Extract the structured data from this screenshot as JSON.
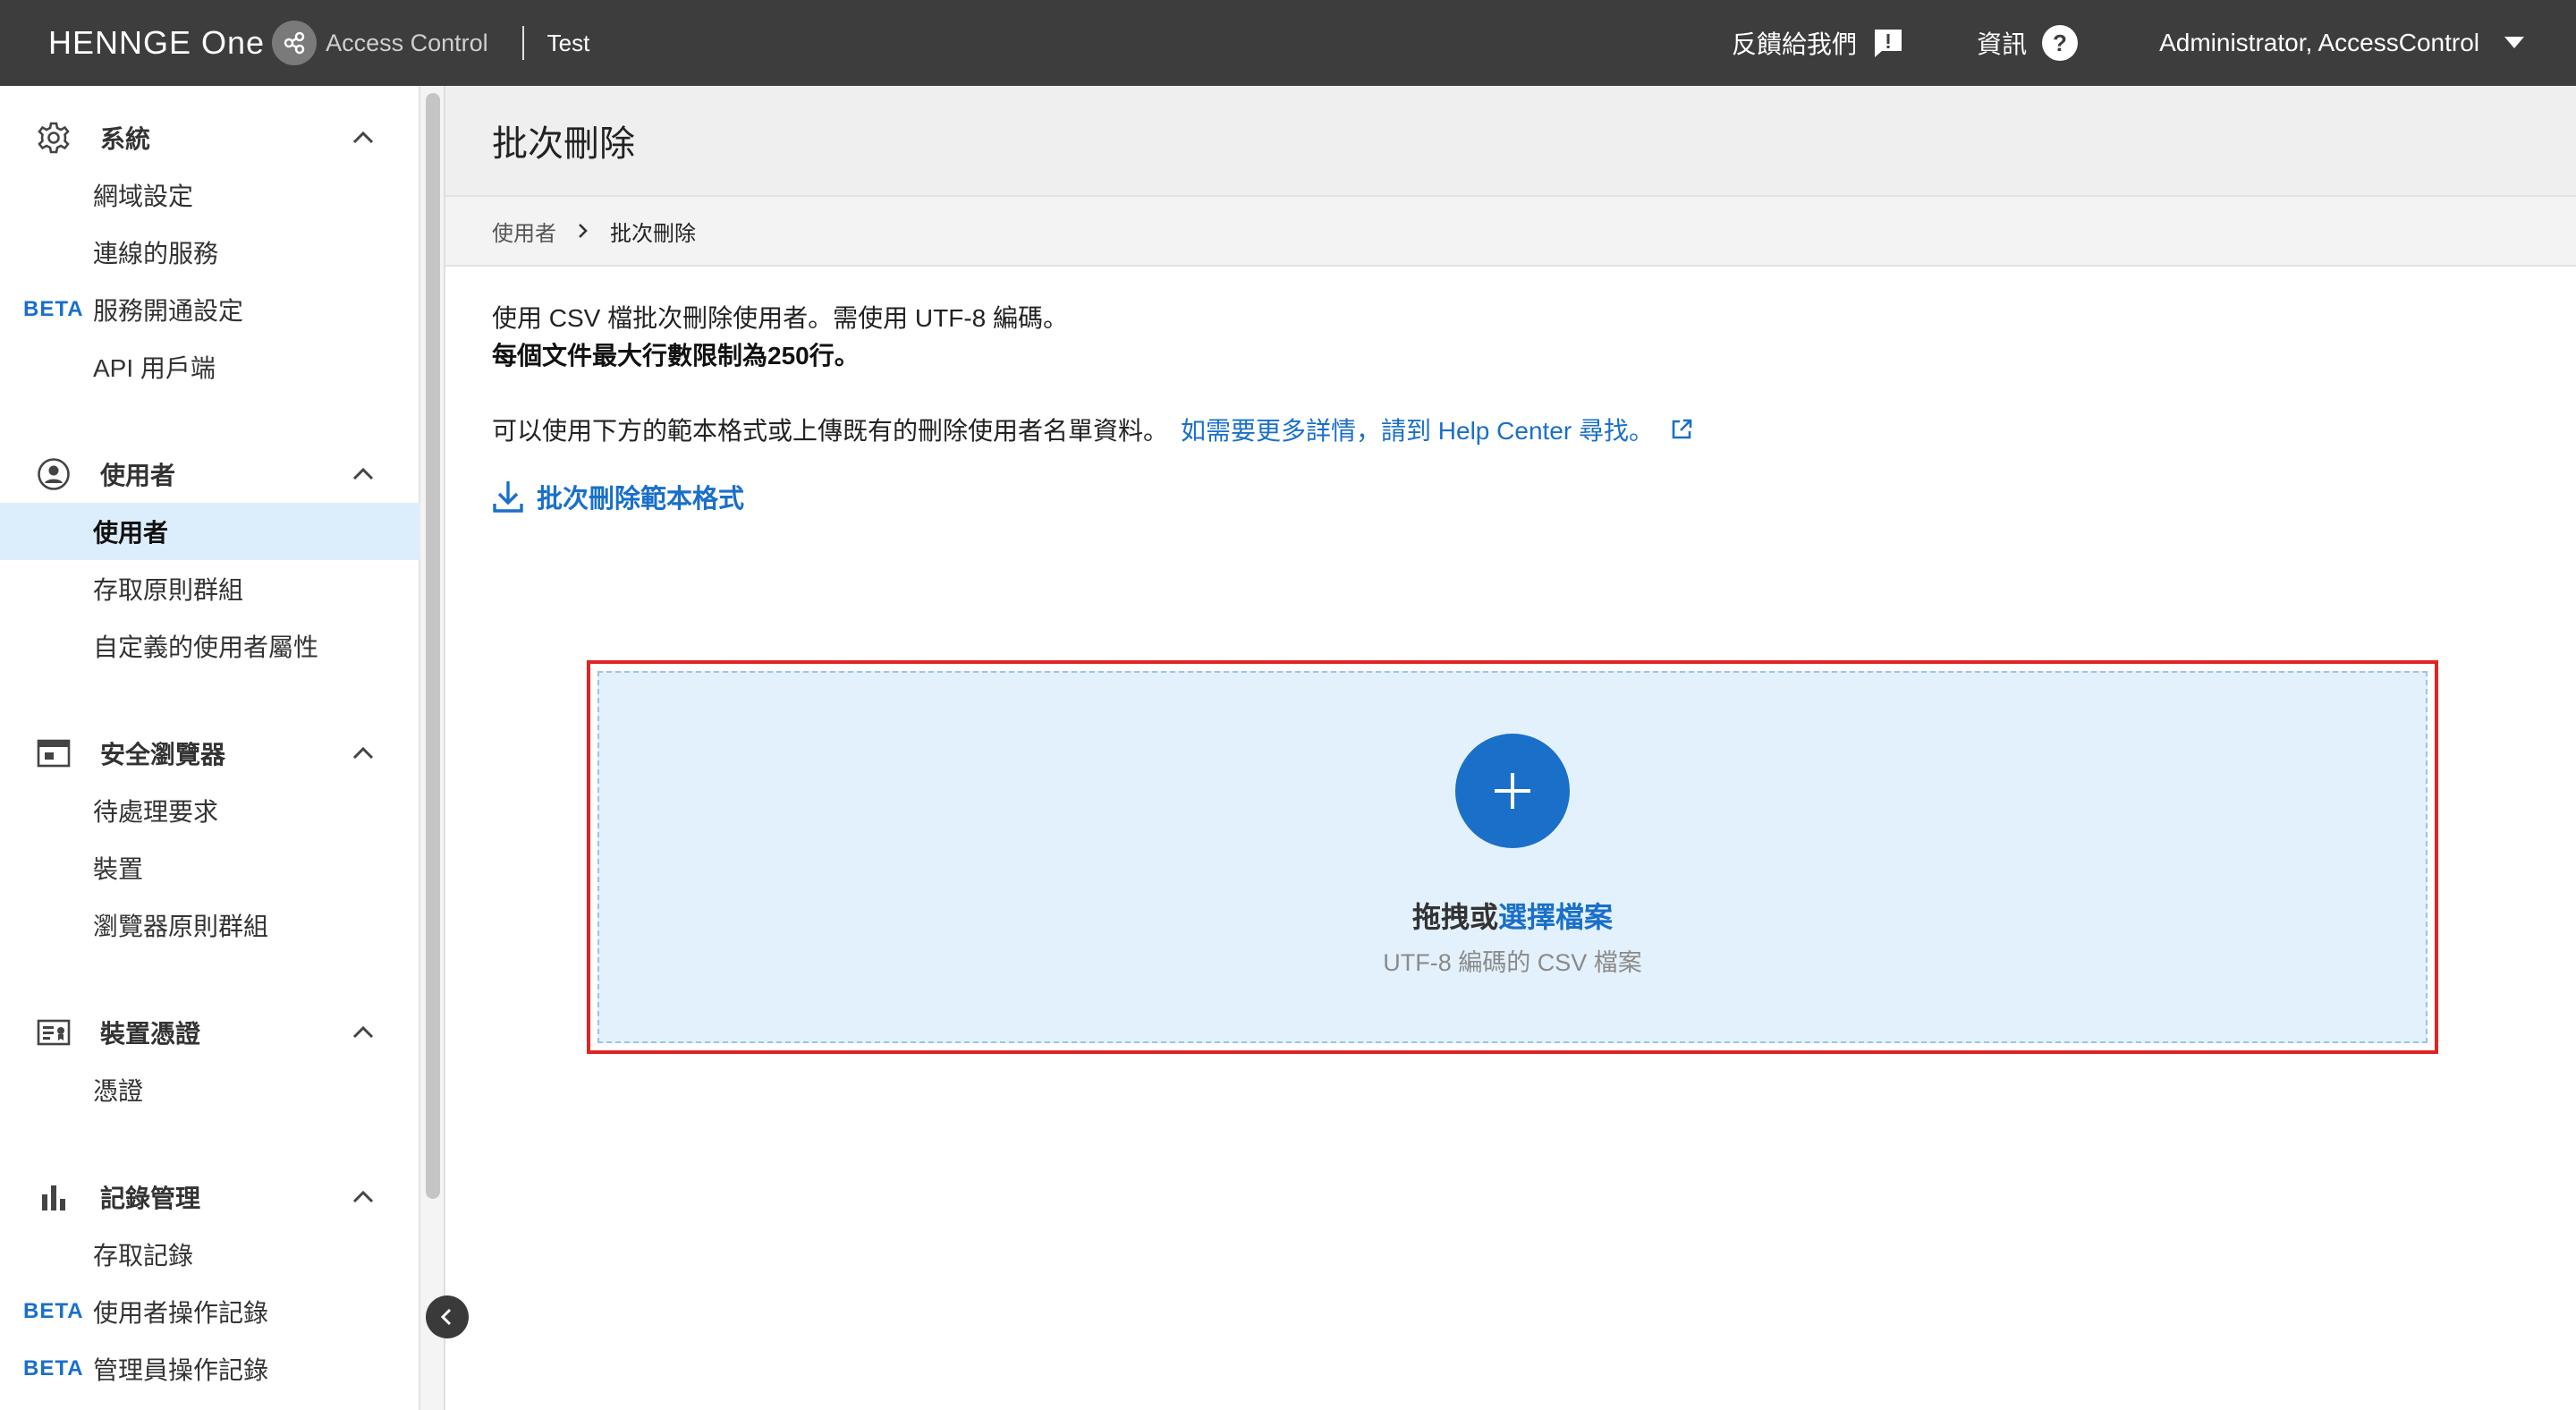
{
  "header": {
    "brand_name": "HENNGE One",
    "brand_product": "Access Control",
    "tenant": "Test",
    "feedback_label": "反饋給我們",
    "info_label": "資訊",
    "account_name": "Administrator, AccessControl"
  },
  "sidebar": {
    "sections": [
      {
        "title": "系統",
        "icon": "gear-icon",
        "items": [
          {
            "label": "網域設定",
            "beta": ""
          },
          {
            "label": "連線的服務",
            "beta": ""
          },
          {
            "label": "服務開通設定",
            "beta": "BETA"
          },
          {
            "label": "API 用戶端",
            "beta": ""
          }
        ]
      },
      {
        "title": "使用者",
        "icon": "user-circle-icon",
        "items": [
          {
            "label": "使用者",
            "beta": "",
            "active": true
          },
          {
            "label": "存取原則群組",
            "beta": ""
          },
          {
            "label": "自定義的使用者屬性",
            "beta": ""
          }
        ]
      },
      {
        "title": "安全瀏覽器",
        "icon": "browser-window-icon",
        "items": [
          {
            "label": "待處理要求",
            "beta": ""
          },
          {
            "label": "裝置",
            "beta": ""
          },
          {
            "label": "瀏覽器原則群組",
            "beta": ""
          }
        ]
      },
      {
        "title": "裝置憑證",
        "icon": "certificate-card-icon",
        "items": [
          {
            "label": "憑證",
            "beta": ""
          }
        ]
      },
      {
        "title": "記錄管理",
        "icon": "bar-chart-icon",
        "items": [
          {
            "label": "存取記錄",
            "beta": ""
          },
          {
            "label": "使用者操作記錄",
            "beta": "BETA"
          },
          {
            "label": "管理員操作記錄",
            "beta": "BETA"
          }
        ]
      }
    ]
  },
  "main": {
    "title": "批次刪除",
    "breadcrumb": {
      "parent": "使用者",
      "current": "批次刪除"
    },
    "description_line1": "使用 CSV 檔批次刪除使用者。需使用 UTF-8 編碼。",
    "description_line2": "每個文件最大行數限制為250行。",
    "description_line3": "可以使用下方的範本格式或上傳既有的刪除使用者名單資料。",
    "help_link": "如需要更多詳情，請到 Help Center 尋找。",
    "template_link": "批次刪除範本格式",
    "dropzone": {
      "drag_text": "拖拽或",
      "choose_text": "選擇檔案",
      "hint": "UTF-8 編碼的 CSV 檔案"
    }
  },
  "colors": {
    "header_bg": "#3d3d3d",
    "accent": "#1a6fc9",
    "active_nav_bg": "#dcedfb",
    "dropzone_bg": "#e3f1fc",
    "highlight_border": "#e02424"
  }
}
